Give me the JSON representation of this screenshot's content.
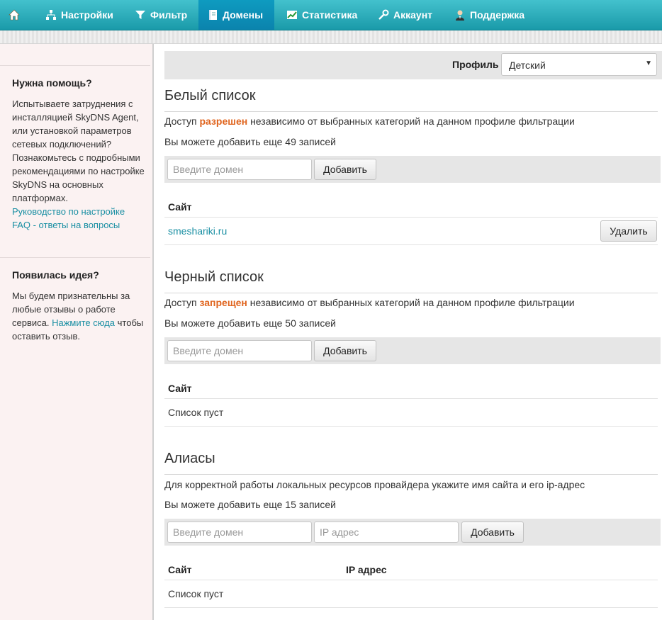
{
  "nav": {
    "home_icon": "home-icon",
    "items": [
      {
        "label": "Настройки",
        "icon": "settings-tree-icon"
      },
      {
        "label": "Фильтр",
        "icon": "funnel-icon"
      },
      {
        "label": "Домены",
        "icon": "book-icon",
        "active": true
      },
      {
        "label": "Статистика",
        "icon": "chart-icon"
      },
      {
        "label": "Аккаунт",
        "icon": "wrench-icon"
      },
      {
        "label": "Поддержка",
        "icon": "user-icon"
      }
    ]
  },
  "sidebar": {
    "help_title": "Нужна помощь?",
    "help_text": "Испытываете затруднения с инсталляцией SkyDNS Agent, или установкой параметров сетевых подключений? Познакомьтесь с подробными рекомендациями по настройке SkyDNS на основных платформах.",
    "help_link_guide": "Руководство по настройке",
    "help_link_faq": "FAQ - ответы на вопросы",
    "idea_title": "Появилась идея?",
    "idea_text_before": "Мы будем признательны за любые отзывы о работе сервиса. ",
    "idea_link": "Нажмите сюда",
    "idea_text_after": " чтобы оставить отзыв."
  },
  "profile": {
    "label": "Профиль",
    "value": "Детский"
  },
  "whitelist": {
    "title": "Белый список",
    "desc_before": "Доступ ",
    "desc_highlight": "разрешен",
    "desc_after": " независимо от выбранных категорий на данном профиле фильтрации",
    "remaining": "Вы можете добавить еще 49 записей",
    "input_placeholder": "Введите домен",
    "add_label": "Добавить",
    "col_site": "Сайт",
    "rows": [
      {
        "site": "smeshariki.ru",
        "action": "Удалить"
      }
    ]
  },
  "blacklist": {
    "title": "Черный список",
    "desc_before": "Доступ ",
    "desc_highlight": "запрещен",
    "desc_after": " независимо от выбранных категорий на данном профиле фильтрации",
    "remaining": "Вы можете добавить еще 50 записей",
    "input_placeholder": "Введите домен",
    "add_label": "Добавить",
    "col_site": "Сайт",
    "empty": "Список пуст"
  },
  "aliases": {
    "title": "Алиасы",
    "desc": "Для корректной работы локальных ресурсов провайдера укажите имя сайта и его ip-адрес",
    "remaining": "Вы можете добавить еще 15 записей",
    "domain_placeholder": "Введите домен",
    "ip_placeholder": "IP адрес",
    "add_label": "Добавить",
    "col_site": "Сайт",
    "col_ip": "IP адрес",
    "empty": "Список пуст"
  },
  "colors": {
    "accent": "#1a9aa9",
    "highlight": "#e0651f",
    "link": "#1a8fa3"
  }
}
